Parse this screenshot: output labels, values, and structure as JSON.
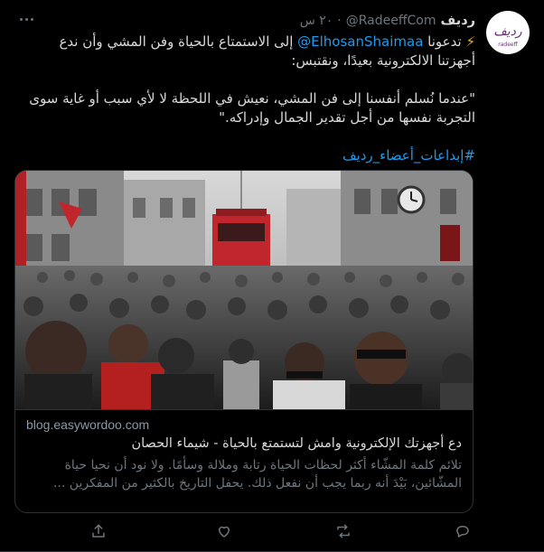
{
  "tweet": {
    "display_name": "رديف",
    "handle": "@RadeeffCom",
    "dot": "·",
    "time": "٢٠ س",
    "avatar": {
      "logo_text": "رديف",
      "logo_sub": "radeeff"
    },
    "text": {
      "line1_prefix": "تدعونا",
      "mention": "@ElhosanShaimaa",
      "line1_suffix": "إلى الاستمتاع بالحياة وفن المشي وأن ندع أجهزتنا الالكترونية بعيدًا، ونقتبس:",
      "quote": "\"عندما نُسلم أنفسنا إلى فن المشي، نعيش في اللحظة لا لأي سبب أو غاية سوى التجربة نفسها من أجل تقدير الجمال وإدراكه.\"",
      "hashtag": "#إبداعات_أعضاء_رديف"
    }
  },
  "card": {
    "domain": "blog.easywordoo.com",
    "title": "دع أجهزتك الإلكترونية وامش لتستمتع بالحياة - شيماء الحصان",
    "description": "تلائم كلمة المشّاء أكثر لحظات الحياة رتابة وملالة وسأمًا. ولا نود أن نحيا حياة المشّائين، بَيْدَ أنه ربما يجب أن نفعل ذلك. يحفل التاريخ بالكثير من المفكرين ..."
  },
  "colors": {
    "background": "#000000",
    "text": "#d9d9d9",
    "muted": "#6e767d",
    "link": "#1d9bf0",
    "border": "#2f3336",
    "tram_red": "#c0262b"
  },
  "icons": [
    "more-icon",
    "lightning-icon",
    "reply-icon",
    "retweet-icon",
    "like-icon",
    "share-icon"
  ]
}
